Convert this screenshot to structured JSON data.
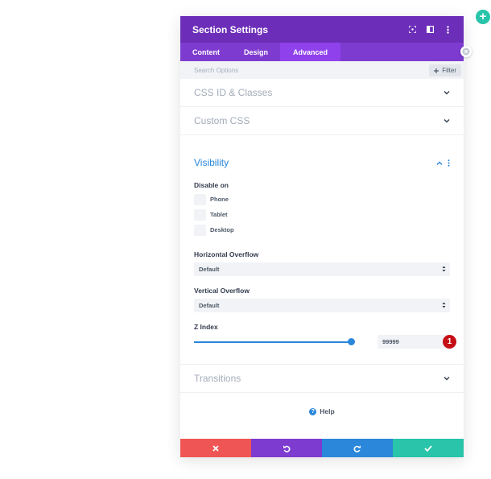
{
  "colors": {
    "header_bg": "#6c2eb9",
    "tabs_bg": "#7e3bd0",
    "active_tab_bg": "#8f42ec",
    "accent_blue": "#2b87da",
    "add_fab": "#29c4a9",
    "cancel": "#ef5555",
    "undo": "#7e3bd0",
    "redo": "#2b87da",
    "save": "#29c4a9",
    "marker": "#c60e15"
  },
  "header": {
    "title": "Section Settings",
    "icons": [
      "expand-icon",
      "sidebar-toggle-icon",
      "more-options-icon"
    ]
  },
  "tabs": [
    {
      "label": "Content",
      "active": false
    },
    {
      "label": "Design",
      "active": false
    },
    {
      "label": "Advanced",
      "active": true
    }
  ],
  "search": {
    "placeholder": "Search Options",
    "filter_label": "Filter"
  },
  "toggles": {
    "css_id": "CSS ID & Classes",
    "custom_css": "Custom CSS",
    "transitions": "Transitions"
  },
  "visibility": {
    "title": "Visibility",
    "disable_on_label": "Disable on",
    "options": [
      {
        "label": "Phone",
        "checked": false
      },
      {
        "label": "Tablet",
        "checked": false
      },
      {
        "label": "Desktop",
        "checked": false
      }
    ],
    "horizontal_overflow": {
      "label": "Horizontal Overflow",
      "value": "Default"
    },
    "vertical_overflow": {
      "label": "Vertical Overflow",
      "value": "Default"
    },
    "z_index": {
      "label": "Z Index",
      "value": "99999",
      "slider_fraction": 0.98
    }
  },
  "marker_number": "1",
  "help_label": "Help",
  "footer": {
    "buttons": [
      "cancel-icon",
      "undo-icon",
      "redo-icon",
      "save-icon"
    ]
  }
}
